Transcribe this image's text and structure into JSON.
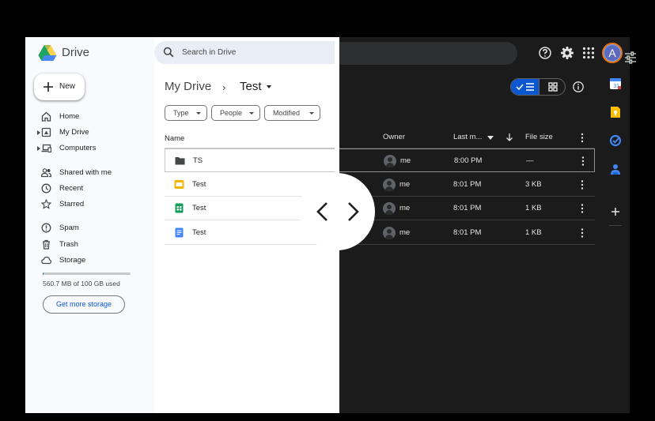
{
  "app": {
    "brand": "Drive"
  },
  "colors": {
    "accent": "#0b57d0",
    "dark_bg": "#1b1b1b",
    "light_bg": "#f8fafd"
  },
  "new_button": {
    "label": "New",
    "icon": "plus-icon"
  },
  "sidebar": {
    "items": [
      {
        "label": "Home",
        "icon": "home-icon"
      },
      {
        "label": "My Drive",
        "icon": "my-drive-icon"
      },
      {
        "label": "Computers",
        "icon": "computers-icon"
      },
      {
        "label": "Shared with me",
        "icon": "shared-icon"
      },
      {
        "label": "Recent",
        "icon": "clock-icon"
      },
      {
        "label": "Starred",
        "icon": "star-icon"
      },
      {
        "label": "Spam",
        "icon": "spam-icon"
      },
      {
        "label": "Trash",
        "icon": "trash-icon"
      },
      {
        "label": "Storage",
        "icon": "cloud-icon"
      }
    ],
    "storage": {
      "used_text": "560.7 MB of 100 GB used",
      "used_fraction": 0.006,
      "button_label": "Get more storage"
    }
  },
  "search": {
    "placeholder": "Search in Drive"
  },
  "breadcrumb": {
    "root": "My Drive",
    "separator": "›",
    "current": "Test"
  },
  "filters": {
    "type": "Type",
    "people": "People",
    "modified": "Modified"
  },
  "columns": {
    "name": "Name",
    "owner": "Owner",
    "last_modified": "Last m...",
    "file_size": "File size"
  },
  "files": [
    {
      "name": "TS",
      "kind": "folder-icon",
      "owner": "me",
      "modified": "8:00 PM",
      "size": "—"
    },
    {
      "name": "Test",
      "kind": "slides-icon",
      "owner": "me",
      "modified": "8:01 PM",
      "size": "3 KB"
    },
    {
      "name": "Test",
      "kind": "sheets-icon",
      "owner": "me",
      "modified": "8:01 PM",
      "size": "1 KB"
    },
    {
      "name": "Test",
      "kind": "docs-icon",
      "owner": "me",
      "modified": "8:01 PM",
      "size": "1 KB"
    }
  ],
  "account": {
    "initial": "A"
  }
}
